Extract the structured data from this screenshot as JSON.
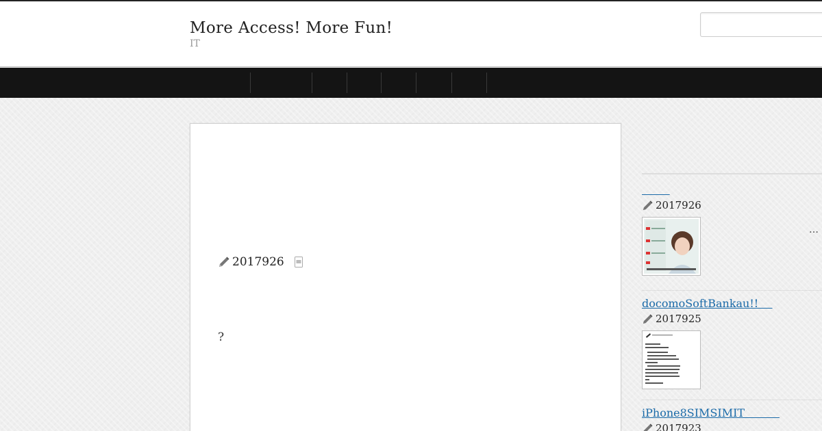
{
  "header": {
    "title": "More Access! More Fun!",
    "description": "IT",
    "search_placeholder": ""
  },
  "nav": {
    "items": [
      "",
      "",
      "",
      "",
      "",
      ""
    ]
  },
  "article": {
    "date": "2017926",
    "body": "?"
  },
  "sidebar": {
    "entries": [
      {
        "title": "        ",
        "date": "2017926",
        "thumb": "woman-portrait-ad-thumbnail"
      },
      {
        "title": "docomoSoftBankau!!    ",
        "date": "2017925",
        "thumb": "japanese-notice-text-thumbnail"
      },
      {
        "title": "iPhone8SIMSIMIT          ",
        "date": "2017923",
        "thumb": ""
      }
    ],
    "more": "…"
  },
  "colors": {
    "nav_bg": "#141414",
    "link": "#1a6aa8",
    "page_bg": "#efefef"
  }
}
